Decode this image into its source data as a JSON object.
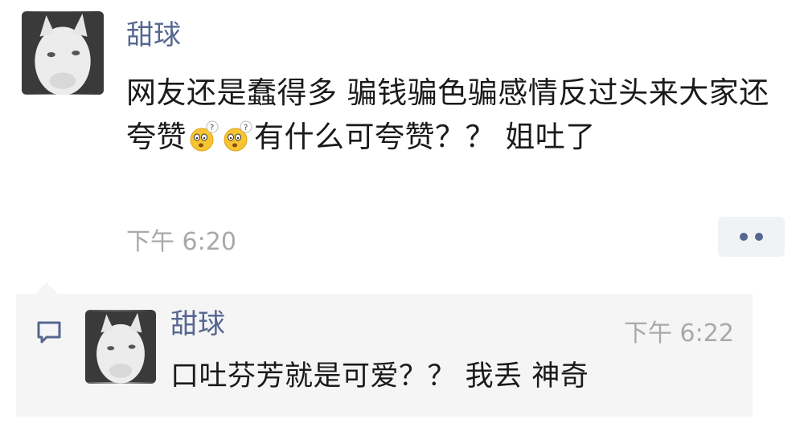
{
  "post": {
    "author": "甜球",
    "text_part1": "网友还是蠢得多 骗钱骗色骗感情反过头来大家还夸赞",
    "emojis": [
      "dizzy-question-emoji",
      "dizzy-question-emoji"
    ],
    "text_part2": "有什么可夸赞？？ 姐吐了",
    "time": "下午 6:20"
  },
  "comment": {
    "author": "甜球",
    "time": "下午 6:22",
    "text": "口吐芬芳就是可爱？？ 我丢 神奇"
  },
  "colors": {
    "name": "#56668f",
    "time": "#a9a9a9",
    "panel_bg": "#f5f5f5",
    "text": "#1a1a1a"
  }
}
